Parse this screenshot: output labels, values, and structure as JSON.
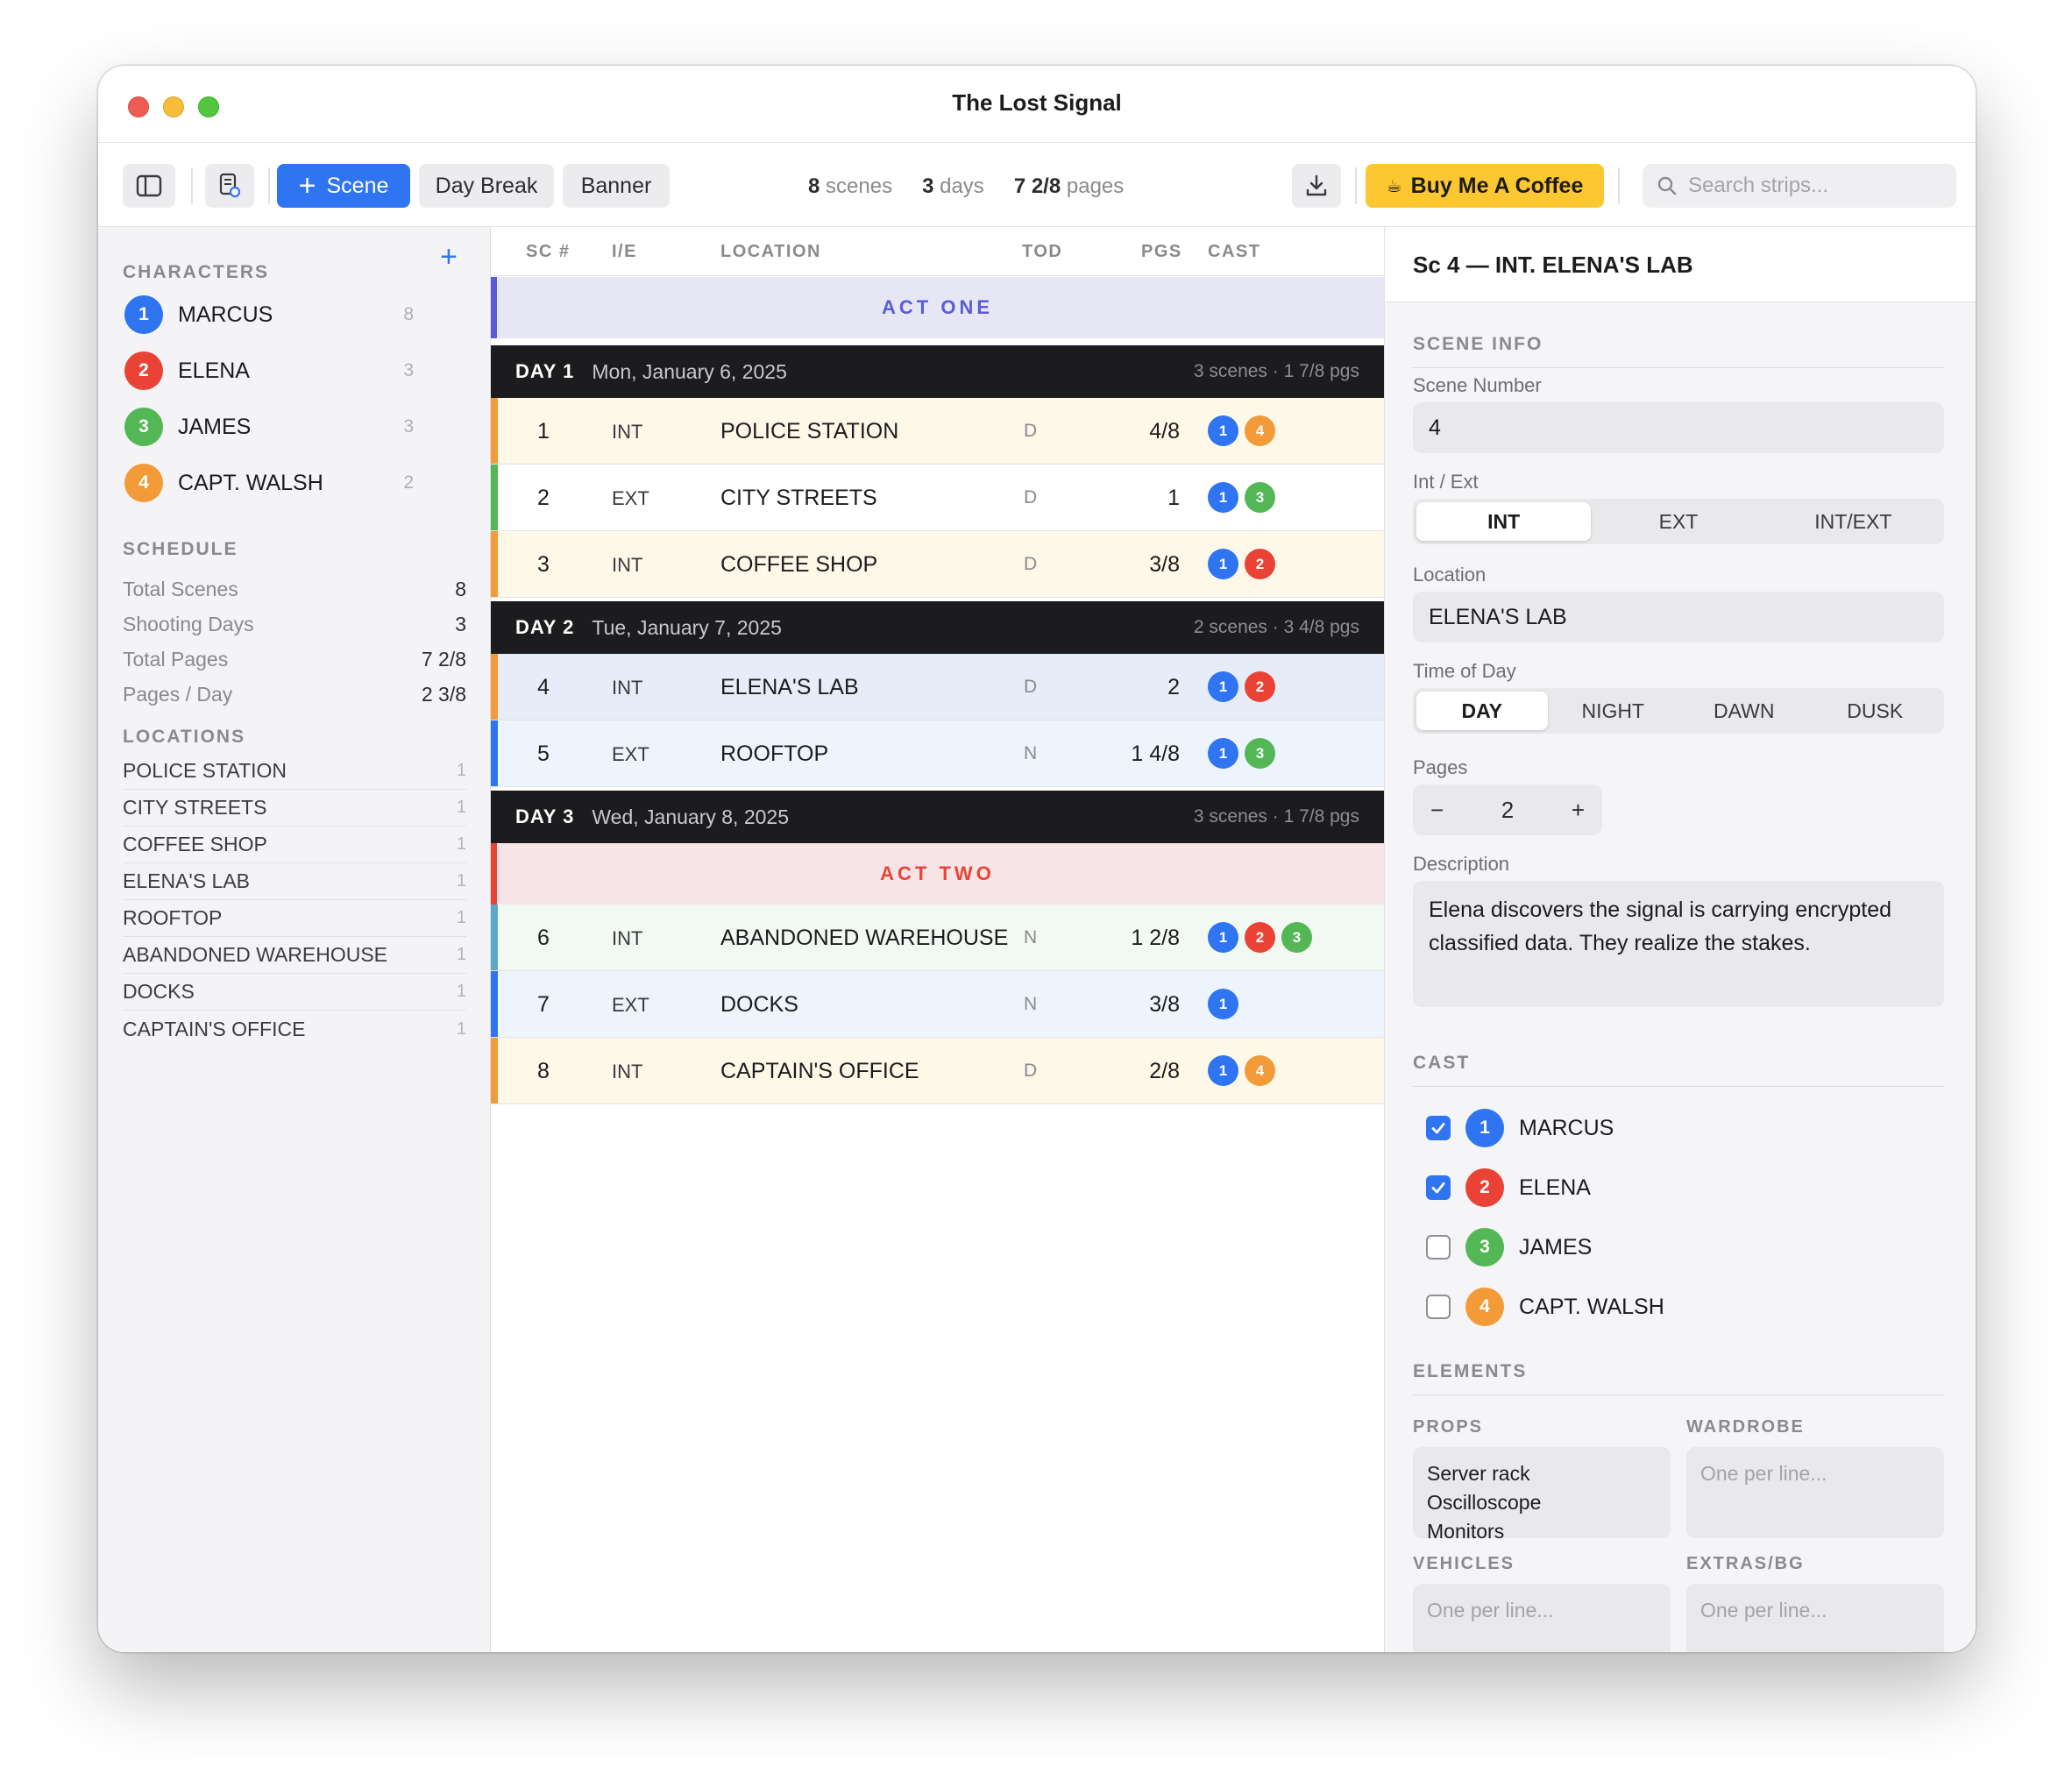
{
  "window": {
    "title": "The Lost Signal"
  },
  "toolbar": {
    "scene_label": "Scene",
    "day_break_label": "Day Break",
    "banner_label": "Banner",
    "stats": [
      {
        "value": "8",
        "unit": "scenes"
      },
      {
        "value": "3",
        "unit": "days"
      },
      {
        "value": "7 2/8",
        "unit": "pages"
      }
    ],
    "coffee_label": "Buy Me A Coffee",
    "search_placeholder": "Search strips..."
  },
  "sidebar": {
    "characters_heading": "CHARACTERS",
    "add_label": "+",
    "characters": [
      {
        "num": "1",
        "name": "MARCUS",
        "count": "8",
        "color": "#2f74f0"
      },
      {
        "num": "2",
        "name": "ELENA",
        "count": "3",
        "color": "#ea4335"
      },
      {
        "num": "3",
        "name": "JAMES",
        "count": "3",
        "color": "#52b754"
      },
      {
        "num": "4",
        "name": "CAPT. WALSH",
        "count": "2",
        "color": "#f29b38"
      }
    ],
    "schedule_heading": "SCHEDULE",
    "schedule": [
      {
        "label": "Total Scenes",
        "value": "8"
      },
      {
        "label": "Shooting Days",
        "value": "3"
      },
      {
        "label": "Total Pages",
        "value": "7 2/8"
      },
      {
        "label": "Pages / Day",
        "value": "2 3/8"
      }
    ],
    "locations_heading": "LOCATIONS",
    "locations": [
      {
        "name": "POLICE STATION",
        "count": "1"
      },
      {
        "name": "CITY STREETS",
        "count": "1"
      },
      {
        "name": "COFFEE SHOP",
        "count": "1"
      },
      {
        "name": "ELENA'S LAB",
        "count": "1"
      },
      {
        "name": "ROOFTOP",
        "count": "1"
      },
      {
        "name": "ABANDONED WAREHOUSE",
        "count": "1"
      },
      {
        "name": "DOCKS",
        "count": "1"
      },
      {
        "name": "CAPTAIN'S OFFICE",
        "count": "1"
      }
    ]
  },
  "strip_board": {
    "columns": {
      "sc": "SC #",
      "ie": "I/E",
      "location": "LOCATION",
      "tod": "TOD",
      "pgs": "PGS",
      "cast": "CAST"
    },
    "banners": [
      {
        "label": "ACT ONE",
        "bg": "#e6e6f4",
        "bar": "#5b5bd6",
        "text": "#5b5bd6"
      },
      {
        "label": "ACT TWO",
        "bg": "#f7e4e6",
        "bar": "#ea4335",
        "text": "#ea4335"
      }
    ],
    "days": [
      {
        "label": "DAY 1",
        "date": "Mon, January 6, 2025",
        "summary": "3 scenes · 1 7/8 pgs"
      },
      {
        "label": "DAY 2",
        "date": "Tue, January 7, 2025",
        "summary": "2 scenes · 3 4/8 pgs"
      },
      {
        "label": "DAY 3",
        "date": "Wed, January 8, 2025",
        "summary": "3 scenes · 1 7/8 pgs"
      }
    ],
    "strips": [
      {
        "num": "1",
        "ie": "INT",
        "location": "POLICE STATION",
        "tod": "D",
        "pgs": "4/8",
        "cast": [
          "1",
          "4"
        ],
        "bg": "#fdf8e8",
        "bar": "#f29b38"
      },
      {
        "num": "2",
        "ie": "EXT",
        "location": "CITY STREETS",
        "tod": "D",
        "pgs": "1",
        "cast": [
          "1",
          "3"
        ],
        "bg": "#ffffff",
        "bar": "#52b754"
      },
      {
        "num": "3",
        "ie": "INT",
        "location": "COFFEE SHOP",
        "tod": "D",
        "pgs": "3/8",
        "cast": [
          "1",
          "2"
        ],
        "bg": "#fdf8e8",
        "bar": "#f29b38"
      },
      {
        "num": "4",
        "ie": "INT",
        "location": "ELENA'S LAB",
        "tod": "D",
        "pgs": "2",
        "cast": [
          "1",
          "2"
        ],
        "bg": "#e6ecf8",
        "bar": "#f29b38"
      },
      {
        "num": "5",
        "ie": "EXT",
        "location": "ROOFTOP",
        "tod": "N",
        "pgs": "1 4/8",
        "cast": [
          "1",
          "3"
        ],
        "bg": "#eef4fd",
        "bar": "#2f74f0"
      },
      {
        "num": "6",
        "ie": "INT",
        "location": "ABANDONED WAREHOUSE",
        "tod": "N",
        "pgs": "1 2/8",
        "cast": [
          "1",
          "2",
          "3"
        ],
        "bg": "#f1f9f2",
        "bar": "#5aa9c9"
      },
      {
        "num": "7",
        "ie": "EXT",
        "location": "DOCKS",
        "tod": "N",
        "pgs": "3/8",
        "cast": [
          "1"
        ],
        "bg": "#eef4fd",
        "bar": "#2f74f0"
      },
      {
        "num": "8",
        "ie": "INT",
        "location": "CAPTAIN'S OFFICE",
        "tod": "D",
        "pgs": "2/8",
        "cast": [
          "1",
          "4"
        ],
        "bg": "#fdf8e8",
        "bar": "#f29b38"
      }
    ]
  },
  "detail": {
    "title": "Sc 4 — INT. ELENA'S LAB",
    "scene_info_heading": "SCENE INFO",
    "scene_number_label": "Scene Number",
    "scene_number": "4",
    "int_ext_label": "Int / Ext",
    "int_ext_options": [
      "INT",
      "EXT",
      "INT/EXT"
    ],
    "int_ext_selected": "INT",
    "location_label": "Location",
    "location": "ELENA'S LAB",
    "tod_label": "Time of Day",
    "tod_options": [
      "DAY",
      "NIGHT",
      "DAWN",
      "DUSK"
    ],
    "tod_selected": "DAY",
    "pages_label": "Pages",
    "pages_minus": "−",
    "pages": "2",
    "pages_plus": "+",
    "description_label": "Description",
    "description": "Elena discovers the signal is carrying encrypted classified data. They realize the stakes.",
    "cast_heading": "CAST",
    "cast": [
      {
        "num": "1",
        "name": "MARCUS",
        "checked": true
      },
      {
        "num": "2",
        "name": "ELENA",
        "checked": true
      },
      {
        "num": "3",
        "name": "JAMES",
        "checked": false
      },
      {
        "num": "4",
        "name": "CAPT. WALSH",
        "checked": false
      }
    ],
    "elements_heading": "ELEMENTS",
    "props_label": "PROPS",
    "props_lines": [
      "Server rack",
      "Oscilloscope",
      "Monitors"
    ],
    "wardrobe_label": "WARDROBE",
    "wardrobe_placeholder": "One per line...",
    "vehicles_label": "VEHICLES",
    "vehicles_placeholder": "One per line...",
    "extras_label": "EXTRAS/BG",
    "extras_placeholder": "One per line..."
  }
}
